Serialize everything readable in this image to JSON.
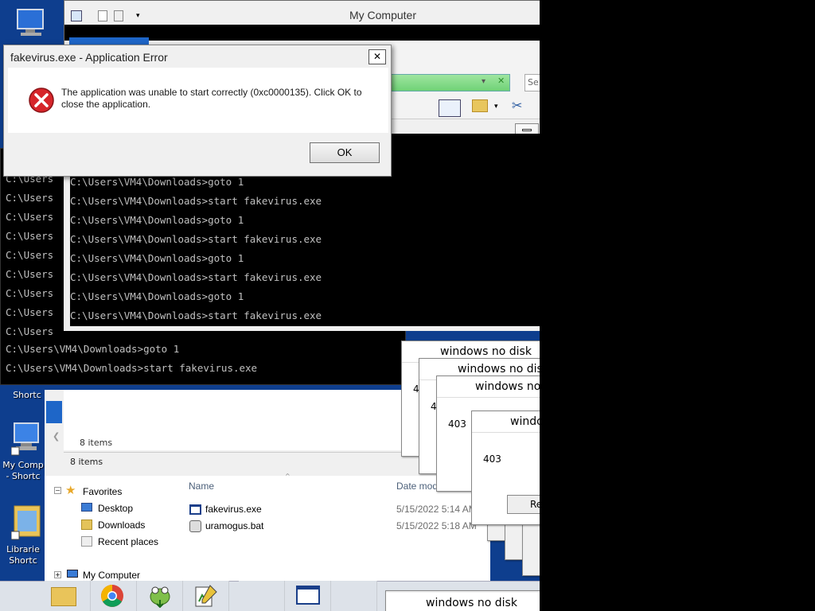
{
  "desktop": {
    "icons": [
      {
        "label": "My Comp - Shortc",
        "icon": "computer-icon"
      },
      {
        "label": "Librarie Shortc",
        "icon": "library-icon"
      },
      {
        "label": "Shortc",
        "icon": "shortcut-icon"
      }
    ]
  },
  "my_computer_window": {
    "title": "My Computer"
  },
  "error_dialog": {
    "title": "fakevirus.exe - Application Error",
    "message": "The application was unable to start correctly (0xc0000135). Click OK to close the application.",
    "ok_label": "OK",
    "close_glyph": "✕",
    "icon": "error-icon"
  },
  "cmd_inner": {
    "lines": [
      "C:\\Users\\VM4\\Downloads>goto 1",
      "C:\\Users\\VM4\\Downloads>start fakevirus.exe",
      "C:\\Users\\VM4\\Downloads>goto 1",
      "C:\\Users\\VM4\\Downloads>start fakevirus.exe",
      "C:\\Users\\VM4\\Downloads>goto 1",
      "C:\\Users\\VM4\\Downloads>start fakevirus.exe",
      "C:\\Users\\VM4\\Downloads>goto 1",
      "C:\\Users\\VM4\\Downloads>start fakevirus.exe"
    ]
  },
  "cmd_outer": {
    "partial_lines": [
      "C:\\Users",
      "C:\\Users",
      "C:\\Users",
      "C:\\Users",
      "C:\\Users",
      "C:\\Users",
      "C:\\Users",
      "C:\\Users",
      "C:\\Users"
    ],
    "lines": [
      "C:\\Users\\VM4\\Downloads>goto 1",
      "C:\\Users\\VM4\\Downloads>start fakevirus.exe"
    ]
  },
  "explorer": {
    "status_items_1": "8 items",
    "status_items_2": "8 items",
    "nav": {
      "favorites": "Favorites",
      "items": [
        "Desktop",
        "Downloads",
        "Recent places"
      ],
      "my_computer": "My Computer"
    },
    "columns": {
      "name": "Name",
      "date": "Date mod"
    },
    "files": [
      {
        "name": "fakevirus.exe",
        "date": "5/15/2022 5:14 AM",
        "icon": "exe-icon"
      },
      {
        "name": "uramogus.bat",
        "date": "5/15/2022 5:18 AM",
        "icon": "bat-icon"
      }
    ]
  },
  "no_disk_dialogs": [
    {
      "title": "windows no disk",
      "code": "40"
    },
    {
      "title": "windows no disk",
      "code": "4"
    },
    {
      "title": "windows no d",
      "code": "403"
    },
    {
      "title": "windo",
      "code": "403",
      "button": "Re"
    }
  ],
  "bottom_dialog": {
    "title": "windows no disk"
  },
  "bottom_left_window": {
    "title": "disk",
    "close_glyph": "✕"
  },
  "taskbar": {
    "buttons": [
      {
        "name": "explorer-task-button",
        "icon": "folder-icon"
      },
      {
        "name": "chrome-task-button",
        "icon": "chrome-icon"
      },
      {
        "name": "gimp-task-button",
        "icon": "frog-icon"
      },
      {
        "name": "notepadpp-task-button",
        "icon": "notepadpp-icon"
      },
      {
        "name": "blank-task-button",
        "icon": ""
      },
      {
        "name": "window-task-button",
        "icon": "window-icon"
      }
    ]
  }
}
